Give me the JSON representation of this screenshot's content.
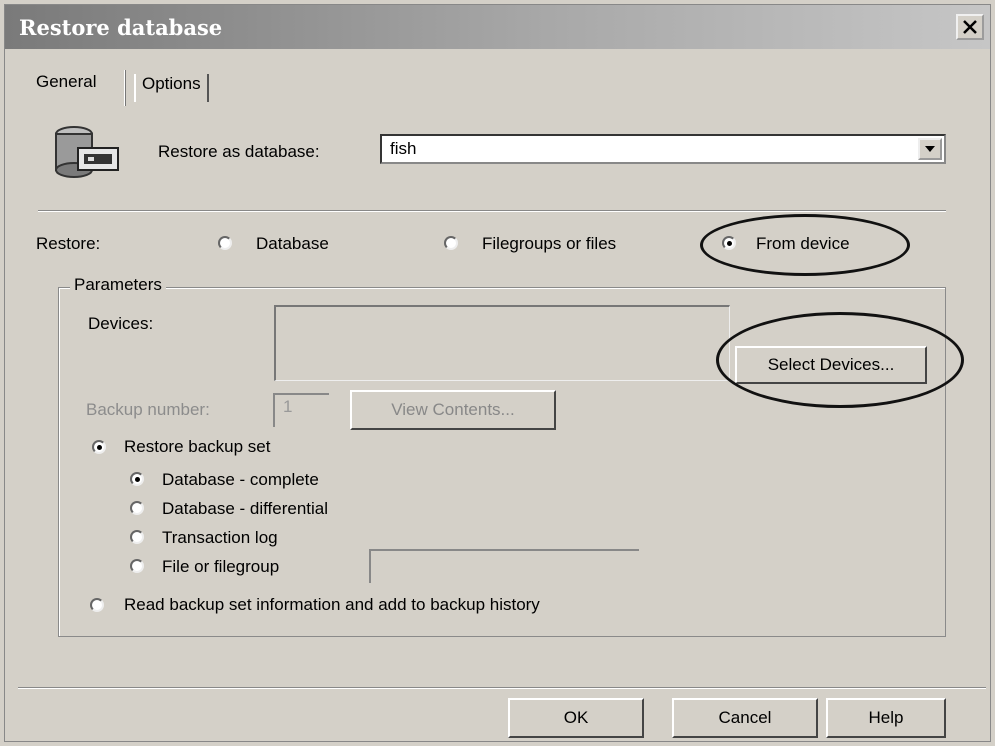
{
  "window": {
    "title": "Restore database"
  },
  "tabs": [
    {
      "label": "General"
    },
    {
      "label": "Options"
    }
  ],
  "restore_as": {
    "label": "Restore as database:",
    "value": "fish"
  },
  "restore": {
    "label": "Restore:",
    "options": [
      {
        "label": "Database",
        "selected": false
      },
      {
        "label": "Filegroups or files",
        "selected": false
      },
      {
        "label": "From device",
        "selected": true
      }
    ]
  },
  "parameters": {
    "title": "Parameters",
    "devices_label": "Devices:",
    "select_devices_label": "Select Devices...",
    "backup_number_label": "Backup number:",
    "backup_number_value": "1",
    "view_contents_label": "View Contents...",
    "restore_backup_set": {
      "label": "Restore backup set",
      "selected": true
    },
    "backup_types": [
      {
        "label": "Database - complete",
        "selected": true
      },
      {
        "label": "Database - differential",
        "selected": false
      },
      {
        "label": "Transaction log",
        "selected": false
      },
      {
        "label": "File or filegroup",
        "selected": false
      }
    ],
    "read_backup_set": {
      "label": "Read backup set information and add to backup history",
      "selected": false
    }
  },
  "buttons": {
    "ok": "OK",
    "cancel": "Cancel",
    "help": "Help"
  }
}
